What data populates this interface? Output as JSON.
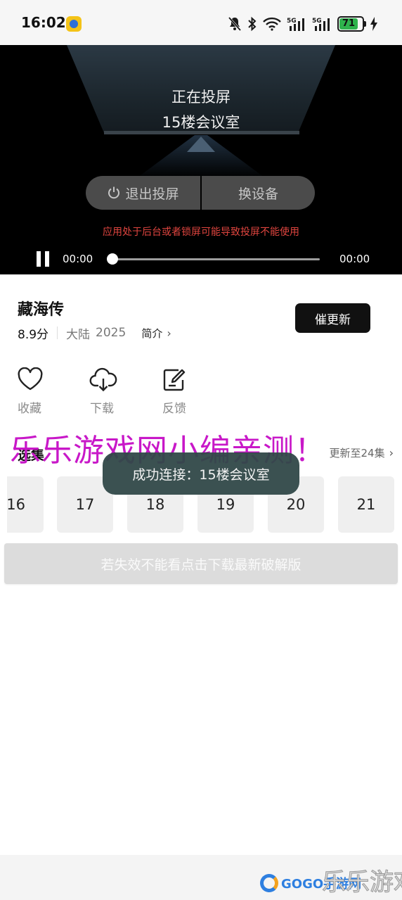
{
  "status_bar": {
    "time": "16:02",
    "signal_1": "5G",
    "signal_2": "5G",
    "battery": "71"
  },
  "player": {
    "cast_status": "正在投屏",
    "cast_room": "15楼会议室",
    "exit_cast_label": "退出投屏",
    "switch_device_label": "换设备",
    "warning": "应用处于后台或者锁屏可能导致投屏不能使用",
    "time_current": "00:00",
    "time_total": "00:00",
    "progress": 0
  },
  "show": {
    "title": "藏海传",
    "rating": "8.9分",
    "region": "大陆",
    "year": "2025",
    "intro_label": "简介",
    "urge_update_label": "催更新"
  },
  "actions": [
    {
      "label": "收藏",
      "icon": "heart-icon"
    },
    {
      "label": "下载",
      "icon": "cloud-download-icon"
    },
    {
      "label": "反馈",
      "icon": "edit-icon"
    }
  ],
  "episodes": {
    "header": "选集",
    "updated": "更新至24集",
    "items": [
      "16",
      "17",
      "18",
      "19",
      "20",
      "21"
    ]
  },
  "toast": "成功连接：15楼会议室",
  "download_banner": "若失效不能看点击下载最新破解版",
  "watermark": "乐乐游戏网小编亲测！",
  "footer": {
    "gogo": "GOGO手游网",
    "brand": "乐乐游戏"
  },
  "colors": {
    "warning": "#e0453f",
    "watermark": "#c818c8",
    "toast_bg": "#304848",
    "battery": "#2fb34d"
  }
}
